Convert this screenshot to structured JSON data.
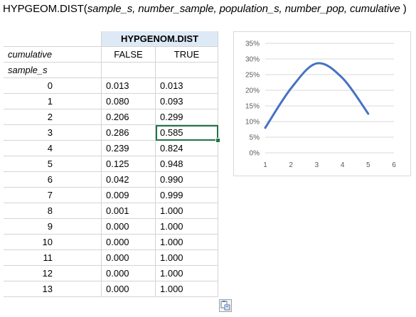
{
  "formula": {
    "name": "HYPGEOM.DIST(",
    "args": "sample_s, number_sample, population_s, number_pop, cumulative",
    "close": " )"
  },
  "table": {
    "header": "HYPGENOM.DIST",
    "cumulative_label": "cumulative",
    "false_label": "FALSE",
    "true_label": "TRUE",
    "sample_label": "sample_s",
    "rows": [
      {
        "s": "0",
        "f": "0.013",
        "t": "0.013"
      },
      {
        "s": "1",
        "f": "0.080",
        "t": "0.093"
      },
      {
        "s": "2",
        "f": "0.206",
        "t": "0.299"
      },
      {
        "s": "3",
        "f": "0.286",
        "t": "0.585"
      },
      {
        "s": "4",
        "f": "0.239",
        "t": "0.824"
      },
      {
        "s": "5",
        "f": "0.125",
        "t": "0.948"
      },
      {
        "s": "6",
        "f": "0.042",
        "t": "0.990"
      },
      {
        "s": "7",
        "f": "0.009",
        "t": "0.999"
      },
      {
        "s": "8",
        "f": "0.001",
        "t": "1.000"
      },
      {
        "s": "9",
        "f": "0.000",
        "t": "1.000"
      },
      {
        "s": "10",
        "f": "0.000",
        "t": "1.000"
      },
      {
        "s": "11",
        "f": "0.000",
        "t": "1.000"
      },
      {
        "s": "12",
        "f": "0.000",
        "t": "1.000"
      },
      {
        "s": "13",
        "f": "0.000",
        "t": "1.000"
      }
    ],
    "selected_row": 3
  },
  "chart_data": {
    "type": "line",
    "x": [
      1,
      2,
      3,
      4,
      5
    ],
    "series": [
      {
        "values": [
          0.08,
          0.206,
          0.286,
          0.239,
          0.125
        ]
      }
    ],
    "xlim": [
      1,
      6
    ],
    "ylim": [
      0,
      0.35
    ],
    "x_ticks": [
      "1",
      "2",
      "3",
      "4",
      "5",
      "6"
    ],
    "y_ticks": [
      "0%",
      "5%",
      "10%",
      "15%",
      "20%",
      "25%",
      "30%",
      "35%"
    ],
    "grid": true,
    "line_color": "#4472c4",
    "title": "",
    "xlabel": "",
    "ylabel": ""
  },
  "icons": {
    "paste_options": "paste-options-icon"
  }
}
